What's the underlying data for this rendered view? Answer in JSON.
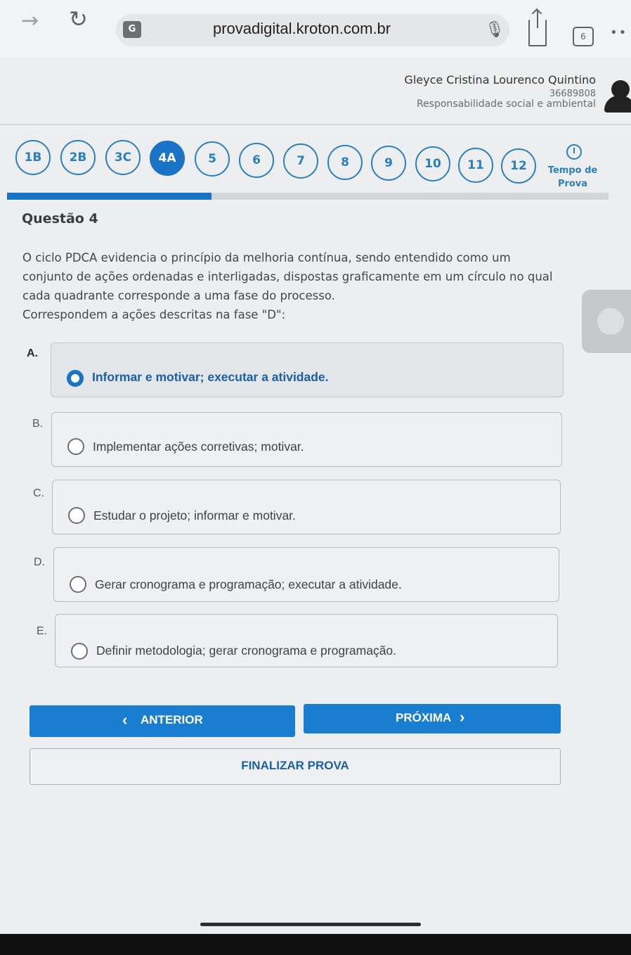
{
  "browser": {
    "url": "provadigital.kroton.com.br",
    "tab_count": "6"
  },
  "user": {
    "name": "Gleyce Cristina Lourenco Quintino",
    "id": "36689808",
    "course": "Responsabilidade social e ambiental"
  },
  "question_nav": {
    "items": [
      {
        "label": "1B",
        "active": false
      },
      {
        "label": "2B",
        "active": false
      },
      {
        "label": "3C",
        "active": false
      },
      {
        "label": "4A",
        "active": true
      },
      {
        "label": "5",
        "active": false
      },
      {
        "label": "6",
        "active": false
      },
      {
        "label": "7",
        "active": false
      },
      {
        "label": "8",
        "active": false
      },
      {
        "label": "9",
        "active": false
      },
      {
        "label": "10",
        "active": false
      },
      {
        "label": "11",
        "active": false
      },
      {
        "label": "12",
        "active": false
      }
    ],
    "timer_label_1": "Tempo de",
    "timer_label_2": "Prova",
    "progress": 0.34
  },
  "question": {
    "title": "Questão 4",
    "line1": "O ciclo PDCA evidencia o princípio da melhoria contínua, sendo entendido como um",
    "line2": "conjunto de ações ordenadas e interligadas, dispostas graficamente em um círculo no qual",
    "line3": "cada quadrante corresponde a uma fase do processo.",
    "line4": "Correspondem a ações descritas na fase \"D\":"
  },
  "options": [
    {
      "letter": "A.",
      "text": "Informar e motivar; executar a atividade.",
      "selected": true
    },
    {
      "letter": "B.",
      "text": "Implementar ações corretivas; motivar.",
      "selected": false
    },
    {
      "letter": "C.",
      "text": "Estudar o projeto; informar e motivar.",
      "selected": false
    },
    {
      "letter": "D.",
      "text": "Gerar cronograma e programação; executar a atividade.",
      "selected": false
    },
    {
      "letter": "E.",
      "text": "Definir metodologia; gerar cronograma e programação.",
      "selected": false
    }
  ],
  "buttons": {
    "prev": "ANTERIOR",
    "next": "PRÓXIMA",
    "finish": "FINALIZAR PROVA"
  },
  "colors": {
    "accent": "#1a73c4",
    "button": "#1a7ed0"
  }
}
